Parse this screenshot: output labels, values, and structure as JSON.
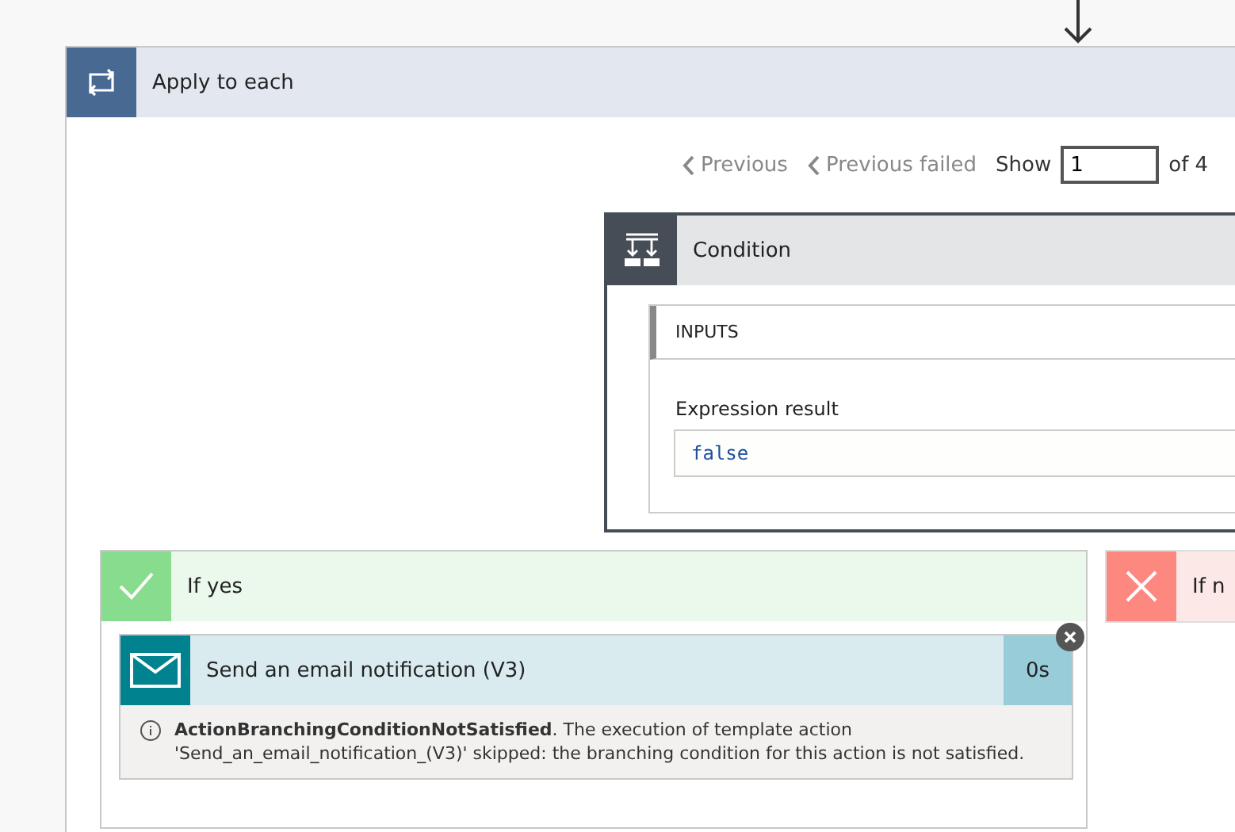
{
  "loop": {
    "title": "Apply to each"
  },
  "pager": {
    "previous": "Previous",
    "previous_failed": "Previous failed",
    "show_label": "Show",
    "value": "1",
    "total": "of 4"
  },
  "condition": {
    "title": "Condition",
    "inputs_heading": "INPUTS",
    "field_label": "Expression result",
    "field_value": "false"
  },
  "branches": [
    {
      "kind": "yes",
      "title": "If yes"
    },
    {
      "kind": "no",
      "title": "If n"
    }
  ],
  "action": {
    "title": "Send an email notification (V3)",
    "duration": "0s",
    "message": "**ActionBranchingConditionNotSatisfied**. The execution of template action 'Send_an_email_notification_(V3)' skipped: the branching condition for this action is not satisfied."
  }
}
